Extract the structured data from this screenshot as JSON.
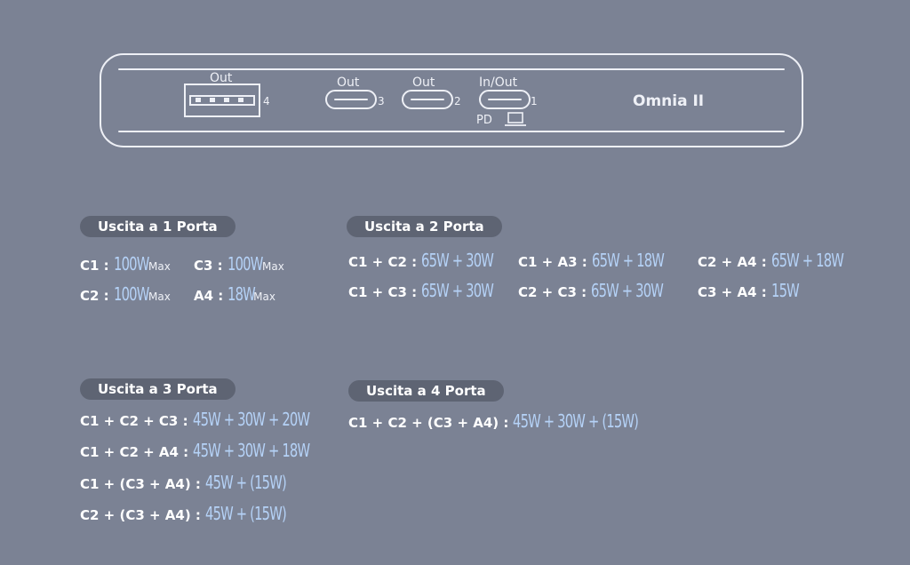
{
  "device": {
    "brand": "Omnia II",
    "ports": [
      {
        "id": "usb-a",
        "label": "Out",
        "number": "4"
      },
      {
        "id": "usb-c3",
        "label": "Out",
        "number": "3"
      },
      {
        "id": "usb-c2",
        "label": "Out",
        "number": "2"
      },
      {
        "id": "usb-c1",
        "label": "In/Out",
        "number": "1",
        "extra": "PD"
      }
    ],
    "icons": [
      "usb-a-port-icon",
      "usb-c-port-icon",
      "laptop-icon"
    ]
  },
  "sections": {
    "one_port": {
      "title": "Uscita a 1 Porta",
      "rows": [
        {
          "key": "C1 :",
          "value": "100W",
          "suffix": "Max"
        },
        {
          "key": "C3 :",
          "value": "100W",
          "suffix": "Max"
        },
        {
          "key": "C2 :",
          "value": "100W",
          "suffix": "Max"
        },
        {
          "key": "A4 :",
          "value": "18W",
          "suffix": "Max"
        }
      ]
    },
    "two_port": {
      "title": "Uscita a 2 Porta",
      "rows": [
        {
          "key": "C1 + C2 :",
          "value": "65W + 30W"
        },
        {
          "key": "C1 + A3 :",
          "value": "65W + 18W"
        },
        {
          "key": "C2 + A4 :",
          "value": "65W + 18W"
        },
        {
          "key": "C1 + C3 :",
          "value": "65W + 30W"
        },
        {
          "key": "C2 + C3 :",
          "value": "65W + 30W"
        },
        {
          "key": "C3 + A4 :",
          "value": "15W"
        }
      ]
    },
    "three_port": {
      "title": "Uscita a 3 Porta",
      "rows": [
        {
          "key": "C1 + C2 + C3 :",
          "value": "45W + 30W + 20W"
        },
        {
          "key": "C1 + C2 + A4 :",
          "value": "45W + 30W + 18W"
        },
        {
          "key": "C1 + (C3 + A4) :",
          "value": "45W + (15W)"
        },
        {
          "key": "C2 + (C3 + A4) :",
          "value": "45W + (15W)"
        }
      ]
    },
    "four_port": {
      "title": "Uscita a 4 Porta",
      "rows": [
        {
          "key": "C1 + C2 + (C3 + A4) :",
          "value": "45W + 30W + (15W)"
        }
      ]
    }
  },
  "colors": {
    "background": "#7b8294",
    "pill": "#5e6473",
    "value": "#b5d2f7",
    "text": "#ffffff"
  }
}
